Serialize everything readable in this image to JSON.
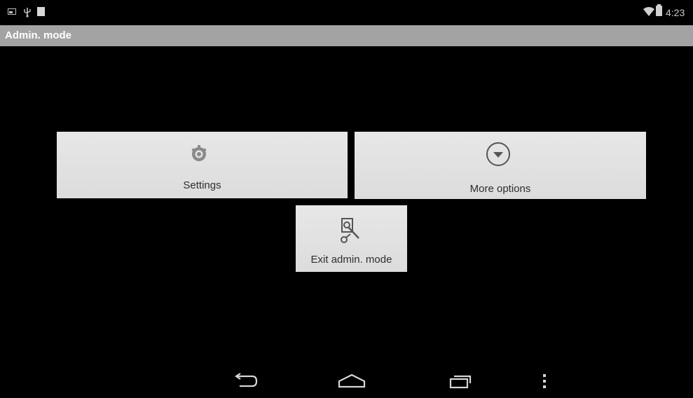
{
  "status_bar": {
    "time": "4:23",
    "icons": [
      "screenshot-icon",
      "usb-icon",
      "storage-icon",
      "wifi-icon",
      "battery-icon"
    ]
  },
  "title_bar": {
    "title": "Admin. mode"
  },
  "tiles": [
    {
      "label": "Settings",
      "icon": "gear-icon"
    },
    {
      "label": "More options",
      "icon": "chevron-down-circle-icon"
    },
    {
      "label": "Exit admin. mode",
      "icon": "wrench-icon"
    }
  ],
  "nav_bar": {
    "buttons": [
      "back-icon",
      "home-icon",
      "recents-icon",
      "menu-icon"
    ]
  },
  "colors": {
    "background": "#000000",
    "title_bar": "#a3a3a3",
    "tile": "#e2e2e2",
    "tile_text": "#2e2e2e"
  }
}
